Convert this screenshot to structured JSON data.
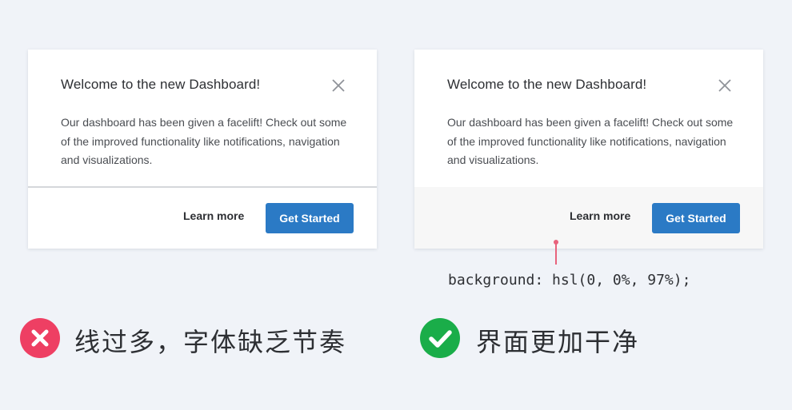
{
  "dialog": {
    "title": "Welcome to the new Dashboard!",
    "body": "Our dashboard has been given a facelift! Check out some of the improved functionality like notifications, navigation and visualizations.",
    "learn_more_label": "Learn more",
    "primary_label": "Get Started",
    "close_icon": "close-icon"
  },
  "annotation": {
    "code": "background: hsl(0, 0%, 97%);"
  },
  "verdicts": {
    "bad_text": "线过多，字体缺乏节奏",
    "good_text": "界面更加干净"
  },
  "colors": {
    "page_bg": "#f0f3f8",
    "primary_button": "#2b7ac5",
    "good_footer_bg": "hsl(0, 0%, 97%)",
    "bad_badge": "#ee3f63",
    "good_badge": "#1aad49",
    "annotation_line": "#e8637c"
  }
}
